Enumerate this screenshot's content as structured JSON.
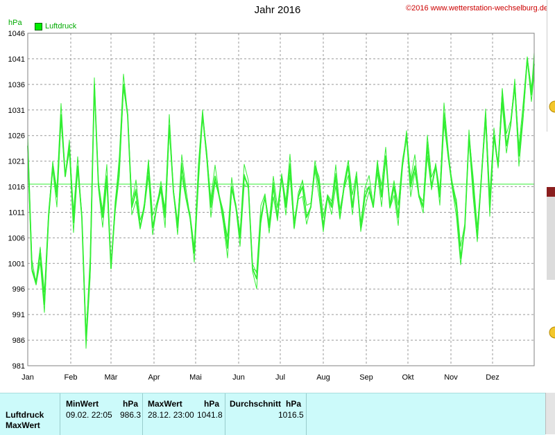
{
  "header": {
    "title": "Jahr 2016",
    "copyright": "©2016 www.wetterstation-wechselburg.de",
    "unit": "hPa",
    "legend_label": "Luftdruck"
  },
  "colors": {
    "series": "#33ee33",
    "grid": "#999999",
    "panel": "#ccfafa",
    "copyright": "#cc0000"
  },
  "chart_data": {
    "type": "line",
    "ylabel": "hPa",
    "ylim": [
      981,
      1046
    ],
    "yticks": [
      "1046",
      "1041",
      "1036",
      "1031",
      "1026",
      "1021",
      "1016",
      "1011",
      "1006",
      "1001",
      "996",
      "991",
      "986",
      "981"
    ],
    "xticks": [
      "Jan",
      "Feb",
      "Mär",
      "Apr",
      "Mai",
      "Jun",
      "Jul",
      "Aug",
      "Sep",
      "Okt",
      "Nov",
      "Dez"
    ],
    "series": [
      {
        "name": "Luftdruck",
        "x_days": [
          0,
          3,
          6,
          9,
          12,
          15,
          18,
          21,
          24,
          27,
          30,
          33,
          36,
          39,
          42,
          45,
          48,
          51,
          54,
          57,
          60,
          63,
          66,
          69,
          72,
          75,
          78,
          81,
          84,
          87,
          90,
          93,
          96,
          99,
          102,
          105,
          108,
          111,
          114,
          117,
          120,
          123,
          126,
          129,
          132,
          135,
          138,
          141,
          144,
          147,
          150,
          153,
          156,
          159,
          162,
          165,
          168,
          171,
          174,
          177,
          180,
          183,
          186,
          189,
          192,
          195,
          198,
          201,
          204,
          207,
          210,
          213,
          216,
          219,
          222,
          225,
          228,
          231,
          234,
          237,
          240,
          243,
          246,
          249,
          252,
          255,
          258,
          261,
          264,
          267,
          270,
          273,
          276,
          279,
          282,
          285,
          288,
          291,
          294,
          297,
          300,
          303,
          306,
          309,
          312,
          315,
          318,
          321,
          324,
          327,
          330,
          333,
          336,
          339,
          342,
          345,
          348,
          351,
          354,
          357,
          360,
          363,
          365
        ],
        "y": [
          1024,
          1000,
          997,
          1003,
          993,
          1010,
          1020,
          1014,
          1030,
          1018,
          1024,
          1009,
          1020,
          1010,
          986,
          1000,
          1036,
          1016,
          1010,
          1018,
          1000,
          1012,
          1020,
          1036,
          1030,
          1012,
          1015,
          1008,
          1012,
          1020,
          1008,
          1012,
          1016,
          1010,
          1028,
          1015,
          1008,
          1020,
          1014,
          1010,
          1003,
          1018,
          1030,
          1022,
          1012,
          1018,
          1014,
          1010,
          1004,
          1016,
          1012,
          1006,
          1018,
          1016,
          1000,
          998,
          1010,
          1014,
          1008,
          1016,
          1010,
          1018,
          1012,
          1020,
          1008,
          1014,
          1016,
          1010,
          1012,
          1020,
          1016,
          1008,
          1014,
          1012,
          1018,
          1010,
          1016,
          1020,
          1012,
          1018,
          1008,
          1014,
          1016,
          1012,
          1020,
          1014,
          1022,
          1012,
          1016,
          1010,
          1020,
          1026,
          1016,
          1020,
          1014,
          1012,
          1024,
          1016,
          1020,
          1014,
          1030,
          1022,
          1016,
          1012,
          1002,
          1008,
          1026,
          1016,
          1006,
          1018,
          1030,
          1012,
          1026,
          1020,
          1034,
          1024,
          1028,
          1036,
          1022,
          1030,
          1041,
          1034,
          1040
        ]
      },
      {
        "name": "MinWert",
        "x_days": [
          39
        ],
        "y": [
          986.3
        ]
      },
      {
        "name": "MaxWert",
        "x_days": [
          362
        ],
        "y": [
          1041.8
        ]
      },
      {
        "name": "Durchschnitt",
        "value": 1016.5
      }
    ]
  },
  "stats": {
    "row_labels": [
      "Luftdruck",
      "MaxWert"
    ],
    "min": {
      "head": "MinWert",
      "unit": "hPa",
      "time": "09.02.  22:05",
      "value": "986.3"
    },
    "max": {
      "head": "MaxWert",
      "unit": "hPa",
      "time": "28.12.  23:00",
      "value": "1041.8"
    },
    "avg": {
      "head": "Durchschnitt",
      "unit": "hPa",
      "value": "1016.5"
    }
  }
}
